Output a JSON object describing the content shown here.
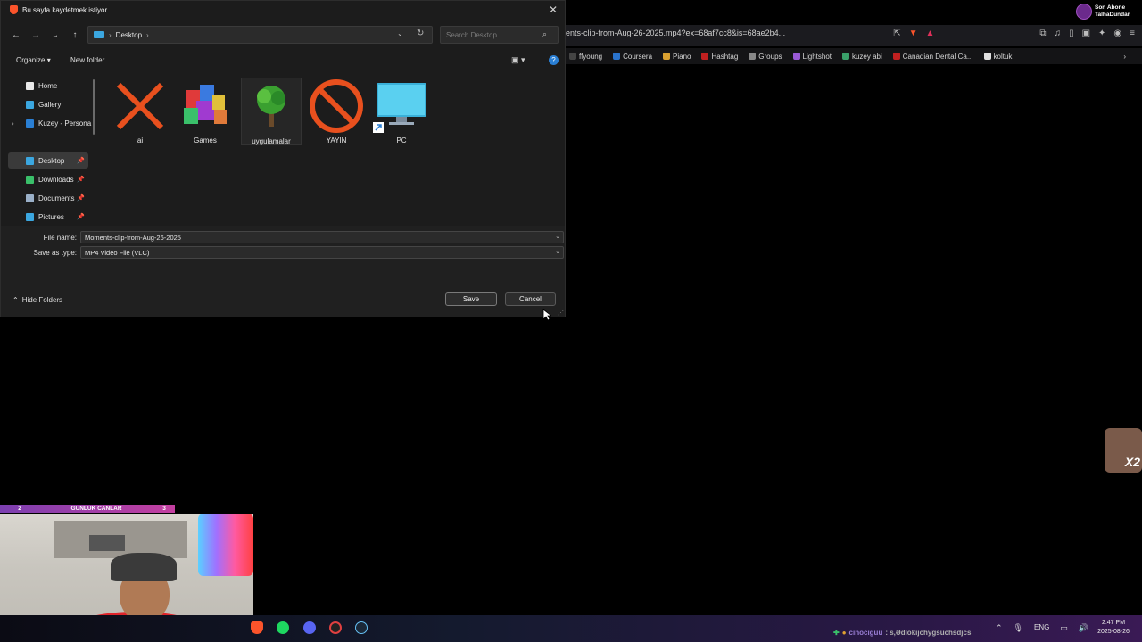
{
  "dialog": {
    "title": "Bu sayfa kaydetmek istiyor",
    "breadcrumb": "Desktop",
    "search_placeholder": "Search Desktop",
    "toolbar": {
      "organize": "Organize",
      "new_folder": "New folder"
    },
    "nav_items": [
      {
        "label": "Home",
        "pinned": false
      },
      {
        "label": "Gallery",
        "pinned": false
      },
      {
        "label": "Kuzey - Persona",
        "pinned": false
      },
      {
        "label": "Desktop",
        "pinned": true,
        "selected": true
      },
      {
        "label": "Downloads",
        "pinned": true
      },
      {
        "label": "Documents",
        "pinned": true
      },
      {
        "label": "Pictures",
        "pinned": true
      }
    ],
    "files": [
      {
        "name": "ai",
        "icon": "red-x-icon"
      },
      {
        "name": "Games",
        "icon": "cubes-icon"
      },
      {
        "name": "uygulamalar",
        "icon": "tree-icon"
      },
      {
        "name": "YAYIN",
        "icon": "prohibited-icon"
      },
      {
        "name": "PC",
        "icon": "monitor-shortcut-icon"
      }
    ],
    "file_name_label": "File name:",
    "file_name_value": "Moments-clip-from-Aug-26-2025",
    "save_type_label": "Save as type:",
    "save_type_value": "MP4 Video File (VLC)",
    "hide_folders": "Hide Folders",
    "save_button": "Save",
    "cancel_button": "Cancel"
  },
  "browser": {
    "url": "ents-clip-from-Aug-26-2025.mp4?ex=68af7cc8&is=68ae2b4...",
    "bookmarks": [
      {
        "label": "ffyoung",
        "color": "#444444"
      },
      {
        "label": "Coursera",
        "color": "#2a73cc"
      },
      {
        "label": "Piano",
        "color": "#d9a030"
      },
      {
        "label": "Hashtag",
        "color": "#c02020"
      },
      {
        "label": "Groups",
        "color": "#888888"
      },
      {
        "label": "Lightshot",
        "color": "#9a5ad6"
      },
      {
        "label": "kuzey abi",
        "color": "#3aa06a"
      },
      {
        "label": "Canadian Dental Ca...",
        "color": "#c02020"
      },
      {
        "label": "koltuk",
        "color": "#e0e0e0"
      }
    ]
  },
  "overlay": {
    "sub_badge_line1": "Son Abone",
    "sub_badge_line2": "TalhaDundar",
    "bar_left": "2",
    "bar_mid": "GUNLUK CANLAR",
    "bar_right": "3",
    "emote_text": "X2"
  },
  "taskbar": {
    "tray_user": "cinociguu",
    "tray_message": ": s,Ədlokijchygsuchsdjcs",
    "lang": "ENG",
    "time": "2:47 PM",
    "date": "2025-08-26"
  },
  "colors": {
    "accent": "#2a7fd4",
    "dialog_bg": "#1c1c1c",
    "brave": "#fb542b"
  }
}
